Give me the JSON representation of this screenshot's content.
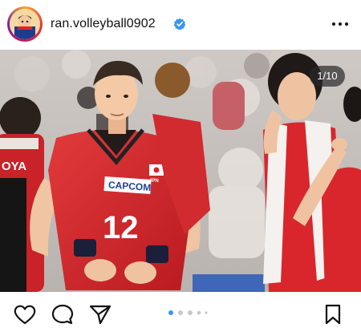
{
  "post": {
    "username": "ran.volleyball0902",
    "verified": true,
    "more_icon": "more-horizontal-icon",
    "avatar_icon": "profile-avatar"
  },
  "photo": {
    "counter": "1/10",
    "jersey_number": "12",
    "sponsor": "CAPCOM",
    "flag": "JPN",
    "teammate_name_partial": "OYA",
    "colors": {
      "jersey_red": "#d8262c",
      "jersey_dark": "#a9151b",
      "crowd": "#c8c3c0"
    }
  },
  "actions": {
    "like_icon": "heart-icon",
    "comment_icon": "comment-icon",
    "share_icon": "send-icon",
    "save_icon": "bookmark-icon",
    "carousel_active": 1,
    "carousel_dots": 5,
    "accent": "#3897f0"
  }
}
